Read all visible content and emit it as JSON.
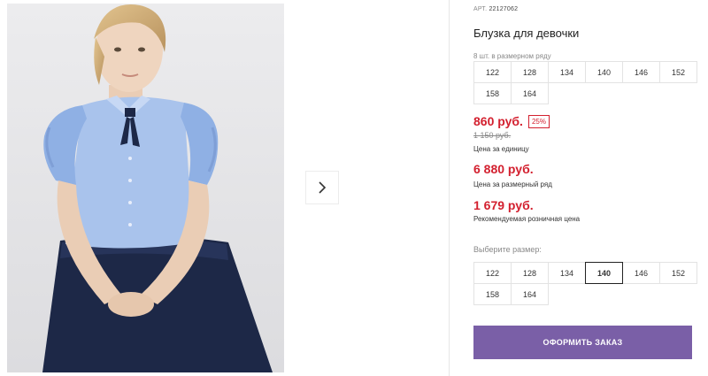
{
  "product": {
    "sku_label": "АРТ.",
    "sku": "22127062",
    "title": "Блузка для девочки"
  },
  "pack_sizes": {
    "note": "8 шт. в размерном ряду",
    "sizes": [
      "122",
      "128",
      "134",
      "140",
      "146",
      "152",
      "158",
      "164"
    ]
  },
  "pricing": {
    "unit_price": "860 руб.",
    "discount": "25%",
    "old_price": "1 150 руб.",
    "unit_caption": "Цена за единицу",
    "pack_price": "6 880 руб.",
    "pack_caption": "Цена за размерный ряд",
    "retail_price": "1 679 руб.",
    "retail_caption": "Рекомендуемая розничная цена"
  },
  "size_select": {
    "label": "Выберите размер:",
    "sizes": [
      "122",
      "128",
      "134",
      "140",
      "146",
      "152",
      "158",
      "164"
    ],
    "selected": "140"
  },
  "actions": {
    "order_label": "ОФОРМИТЬ ЗАКАЗ"
  },
  "gallery": {
    "next_icon": "chevron-right-icon"
  },
  "colors": {
    "price": "#d3202f",
    "button": "#7a5fa7",
    "blouse": "#a9c3ec",
    "skirt": "#1d2847"
  }
}
